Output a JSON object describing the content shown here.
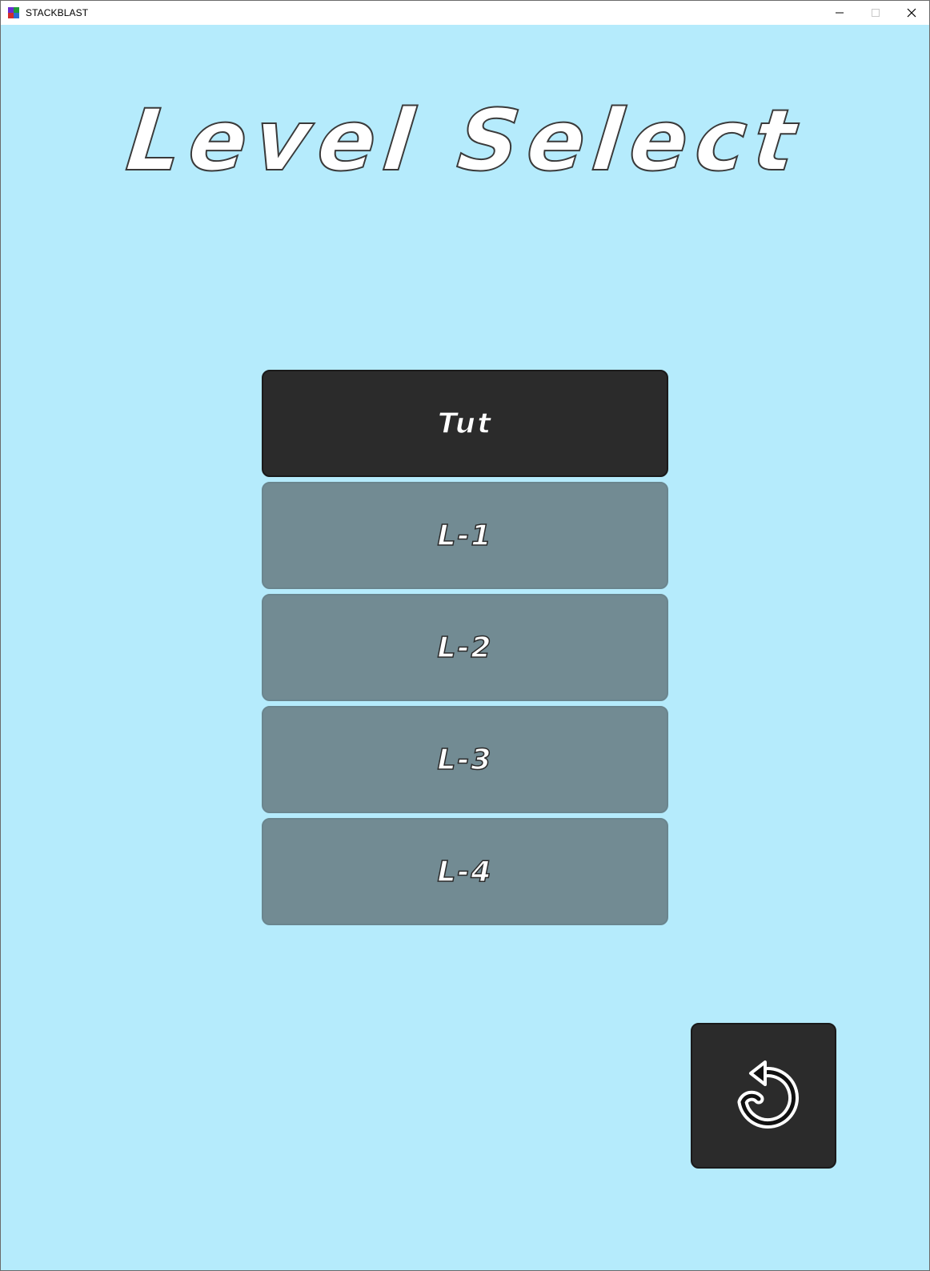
{
  "window": {
    "title": "STACKBLAST",
    "controls": [
      "minimize-icon",
      "maximize-icon",
      "close-icon"
    ]
  },
  "screen": {
    "title": "Level Select",
    "levels": [
      {
        "label": "Tut",
        "state": "selected"
      },
      {
        "label": "L-1",
        "state": "locked"
      },
      {
        "label": "L-2",
        "state": "locked"
      },
      {
        "label": "L-3",
        "state": "locked"
      },
      {
        "label": "L-4",
        "state": "locked"
      }
    ],
    "reset_button_icon": "undo-arrow-icon"
  },
  "colors": {
    "background": "#b5ebfc",
    "button_active": "#2b2b2b",
    "button_locked": "#728b93",
    "text": "#ffffff"
  }
}
